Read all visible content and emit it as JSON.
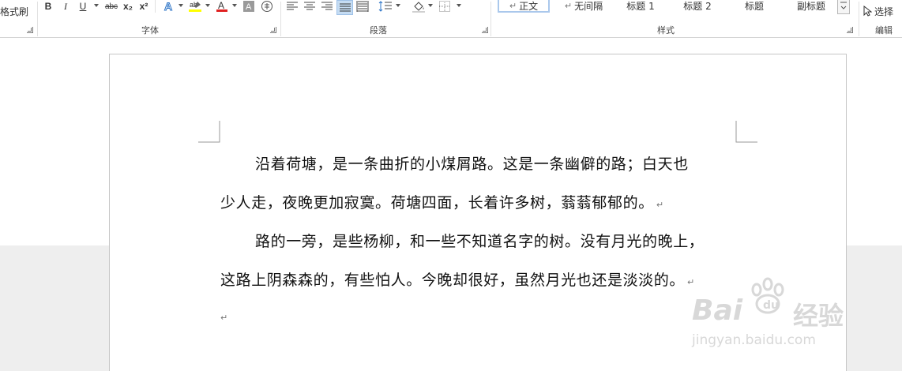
{
  "ribbon": {
    "format_painter": "格式刷",
    "font_group": "字体",
    "paragraph_group": "段落",
    "styles_group": "样式",
    "editing_group": "编辑",
    "bold": "B",
    "italic": "I",
    "underline": "U",
    "strikethrough": "abc",
    "subscript": "x₂",
    "superscript": "x²",
    "select": "选择",
    "styles": [
      "正文",
      "无间隔",
      "标题 1",
      "标题 2",
      "标题",
      "副标题"
    ],
    "colors": {
      "highlight": "#ffff00",
      "font_color": "#e02020",
      "text_effect": "#2e75c7",
      "accent": "#aac8ec"
    }
  },
  "document": {
    "lines": [
      "沿着荷塘，是一条曲折的小煤屑路。这是一条幽僻的路；白天也",
      "少人走，夜晚更加寂寞。荷塘四面，长着许多树，蓊蓊郁郁的。",
      "路的一旁，是些杨柳，和一些不知道名字的树。没有月光的晚上，",
      "这路上阴森森的，有些怕人。今晚却很好，虽然月光也还是淡淡的。"
    ],
    "paragraph_mark": "↵"
  },
  "watermark": {
    "brand": "Bai",
    "brand_cn": "经验",
    "url": "jingyan.baidu.com"
  }
}
